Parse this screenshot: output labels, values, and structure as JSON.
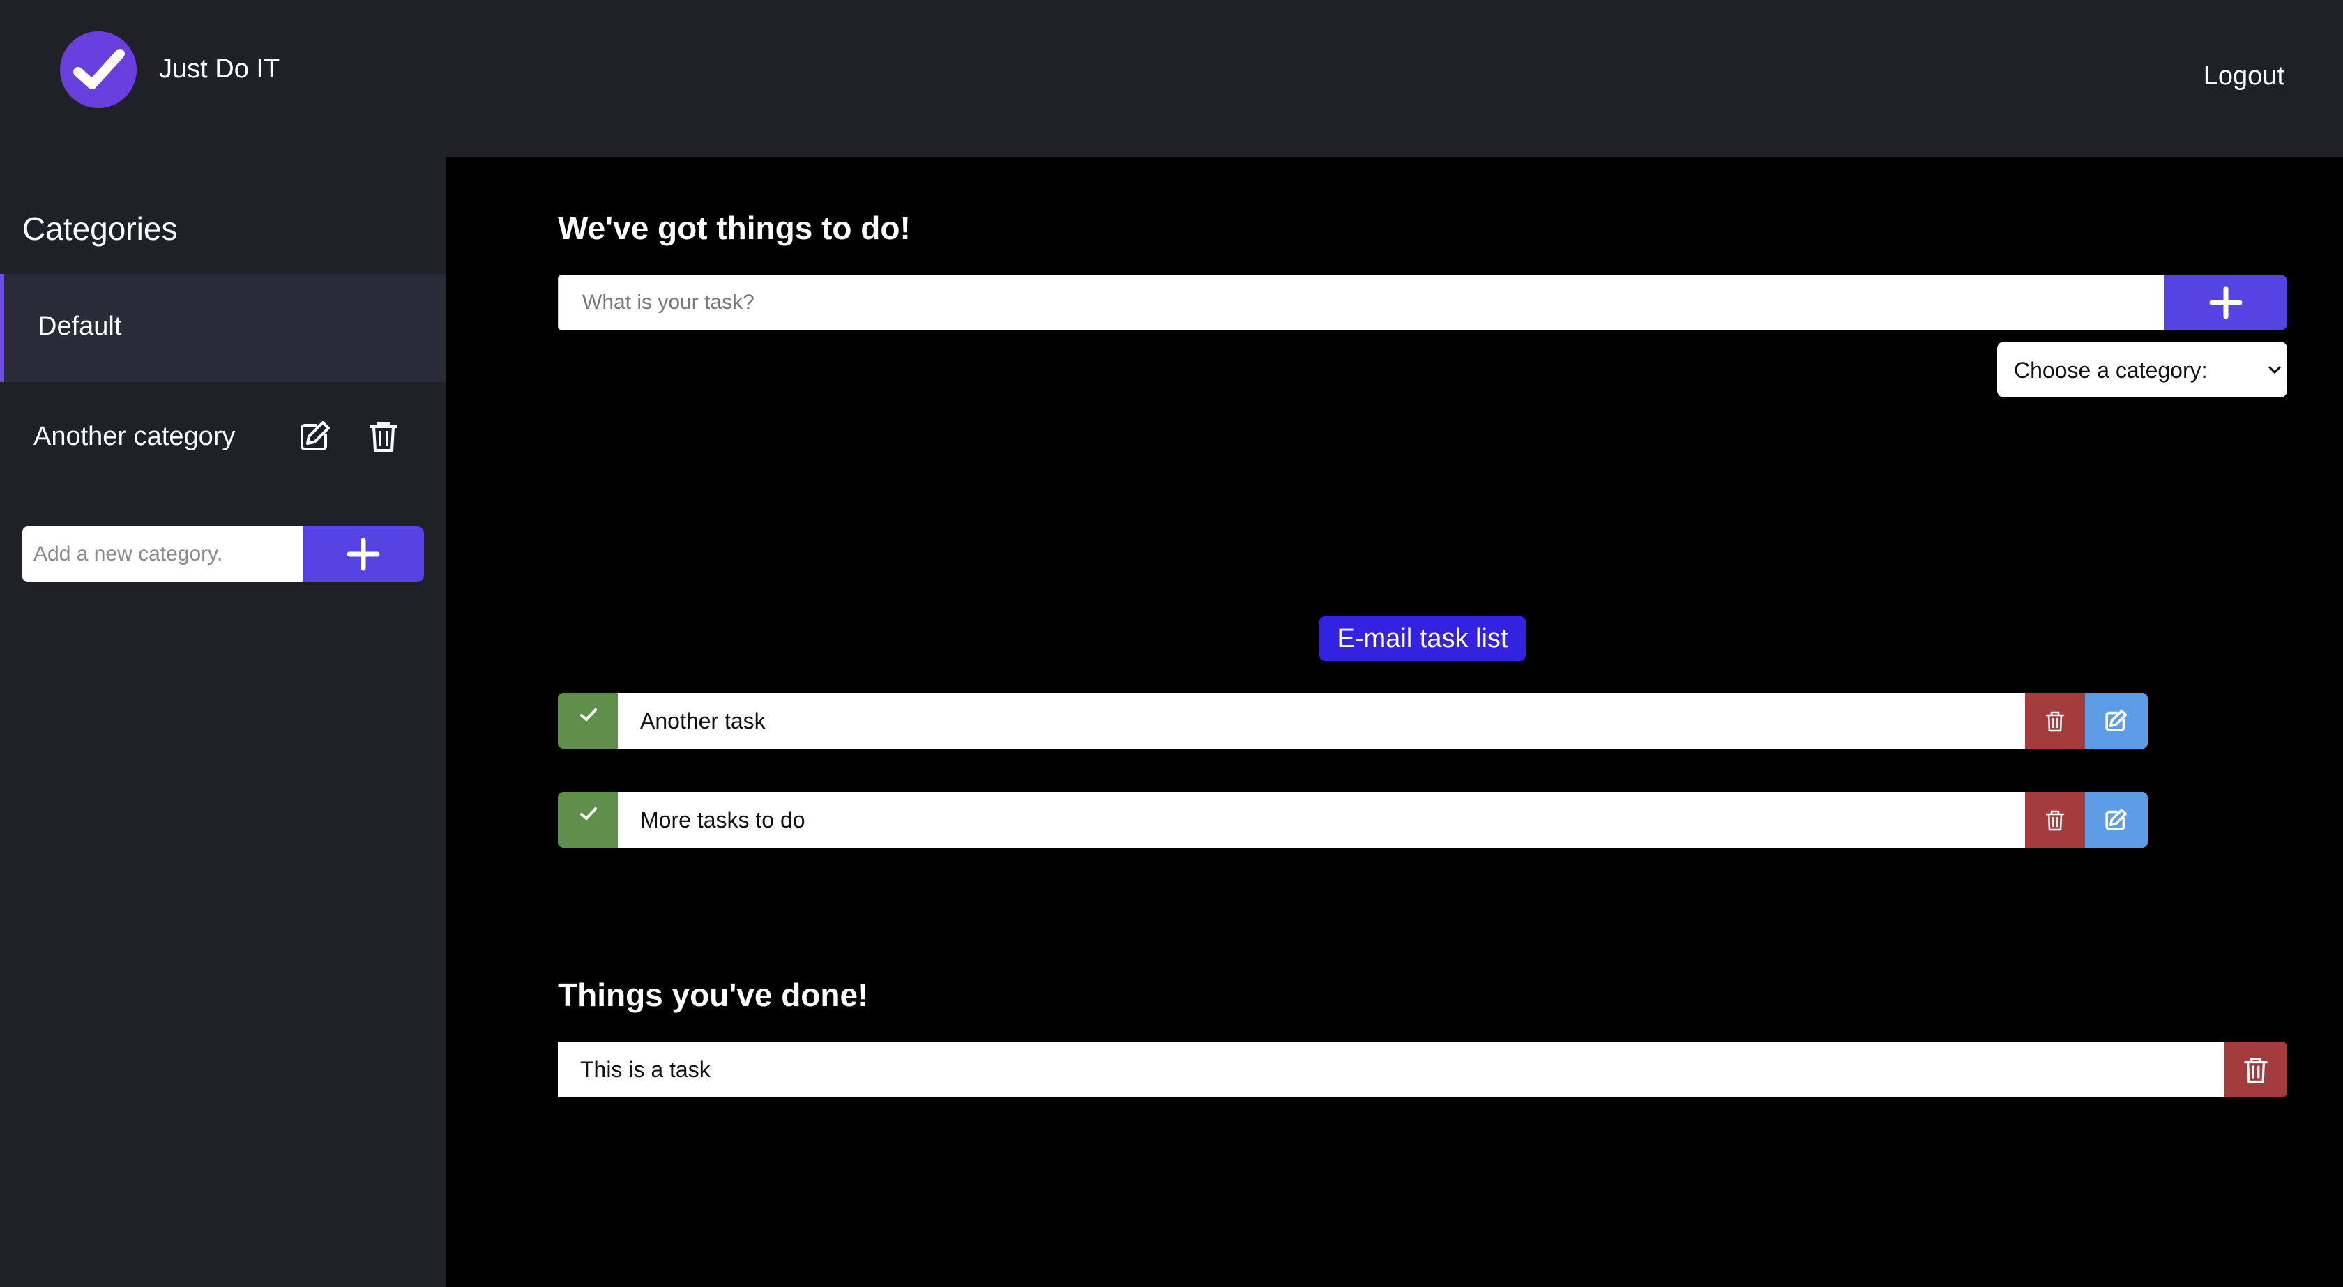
{
  "header": {
    "logo_icon": "check-circle-icon",
    "title": "Just Do IT",
    "logout_label": "Logout"
  },
  "sidebar": {
    "title": "Categories",
    "items": [
      {
        "label": "Default",
        "active": true
      },
      {
        "label": "Another category",
        "active": false,
        "icons": [
          "edit-icon",
          "trash-icon"
        ]
      }
    ],
    "add_placeholder": "Add a new category.",
    "add_icon": "plus-icon"
  },
  "main": {
    "todo_heading": "We've got things to do!",
    "task_placeholder": "What is your task?",
    "category_select": "Choose a category:",
    "email_button": "E-mail task list",
    "tasks": [
      {
        "text": "Another task"
      },
      {
        "text": "More tasks to do"
      }
    ],
    "done_heading": "Things you've done!",
    "done_tasks": [
      {
        "text": "This is a task"
      }
    ]
  },
  "colors": {
    "accent": "#5544e2",
    "check": "#5f8f4b",
    "delete": "#a43b3c",
    "edit": "#5d9de8",
    "email": "#3322e0",
    "panel": "#202126"
  }
}
